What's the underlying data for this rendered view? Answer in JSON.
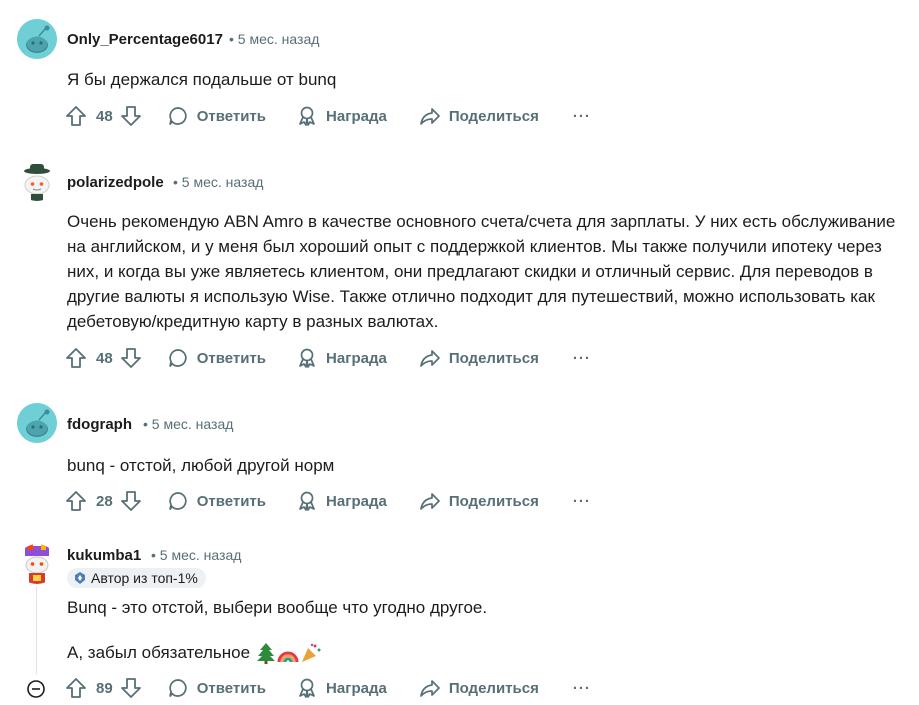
{
  "comments": [
    {
      "author": "Only_Percentage6017",
      "time": "5 мес. назад",
      "text": [
        "Я бы держался подальше от bunq"
      ],
      "votes": "48",
      "reply": "Ответить",
      "award": "Награда",
      "share": "Поделиться",
      "more": "···",
      "avatar_color": "#6ed0d6"
    },
    {
      "author": "polarizedpole",
      "time": "5 мес. назад",
      "text": [
        "Очень рекомендую ABN Amro в качестве основного счета/счета для зарплаты. У них есть обслуживание на английском, и у меня был хороший опыт с поддержкой клиентов. Мы также получили ипотеку через них, и когда вы уже являетесь клиентом, они предлагают скидки и отличный сервис. Для переводов в другие валюты я использую Wise. Также отлично подходит для путешествий, можно использовать как дебетовую/кредитную карту в разных валютах."
      ],
      "votes": "48",
      "reply": "Ответить",
      "award": "Награда",
      "share": "Поделиться",
      "more": "···",
      "avatar_color": "#ffffff"
    },
    {
      "author": "fdograph",
      "time": "5 мес. назад",
      "text": [
        "bunq - отстой, любой другой норм"
      ],
      "votes": "28",
      "reply": "Ответить",
      "award": "Награда",
      "share": "Поделиться",
      "more": "···",
      "avatar_color": "#6ed0d6"
    },
    {
      "author": "kukumba1",
      "time": "5 мес. назад",
      "badge": "Автор из топ-1%",
      "text": [
        "Bunq - это отстой, выбери вообще что угодно другое.",
        "А, забыл обязательное"
      ],
      "votes": "89",
      "reply": "Ответить",
      "award": "Награда",
      "share": "Поделиться",
      "more": "···",
      "avatar_color": "#ffffff"
    }
  ],
  "colors": {
    "meta": "#576f76",
    "text": "#1c1c1c",
    "badge_bg": "#eef1f3",
    "avatar_teal": "#6ed0d6"
  },
  "icons": [
    "upvote-icon",
    "downvote-icon",
    "comment-icon",
    "award-icon",
    "share-icon",
    "more-icon",
    "collapse-icon",
    "badge-icon"
  ]
}
